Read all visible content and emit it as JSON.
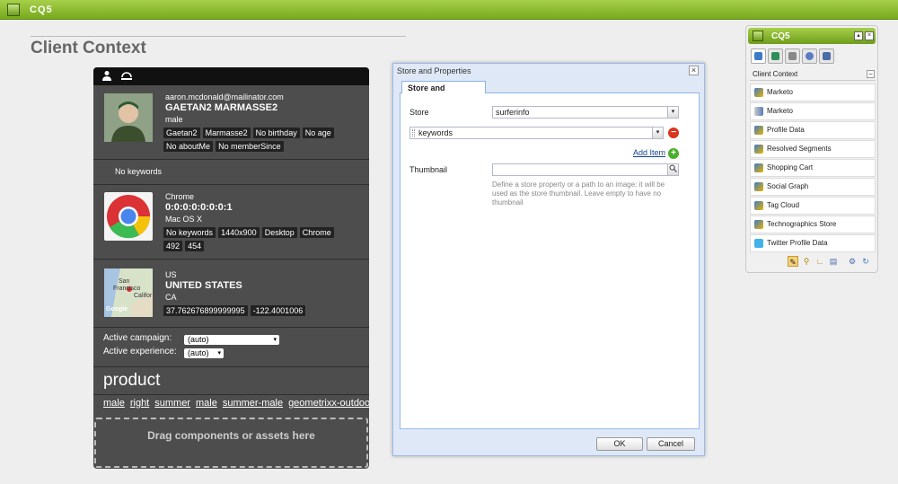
{
  "topbar": {
    "brand": "CQ5"
  },
  "page_title": "Client Context",
  "client_context": {
    "profile": {
      "email": "aaron.mcdonald@mailinator.com",
      "name": "GAETAN2 MARMASSE2",
      "gender": "male",
      "tags": [
        "Gaetan2",
        "Marmasse2",
        "No birthday",
        "No age",
        "No aboutMe",
        "No memberSince"
      ]
    },
    "keywords_text": "No keywords",
    "browser": {
      "name": "Chrome",
      "ip": "0:0:0:0:0:0:0:1",
      "os": "Mac OS X",
      "tags": [
        "No keywords",
        "1440x900",
        "Desktop",
        "Chrome",
        "492",
        "454"
      ]
    },
    "geo": {
      "country_code": "US",
      "country": "UNITED STATES",
      "region": "CA",
      "map_labels": [
        "San",
        "Francisco",
        "Califor",
        "Google"
      ],
      "tags": [
        "37.762676899999995",
        "-122.4001006"
      ]
    },
    "campaign": {
      "label": "Active campaign:",
      "value": "(auto)"
    },
    "experience": {
      "label": "Active experience:",
      "value": "(auto)"
    },
    "product_heading": "product",
    "segments": [
      "male",
      "right",
      "summer",
      "male",
      "summer-male",
      "geometrixx-outdoors"
    ],
    "dropzone": "Drag components or assets here"
  },
  "dialog": {
    "title": "Store and Properties",
    "tab": "Store and Properties",
    "store_label": "Store",
    "store_value": "surferinfo",
    "keyword_value": "keywords",
    "add_item": "Add Item",
    "thumbnail_label": "Thumbnail",
    "thumbnail_value": "",
    "hint": "Define a store property or a path to an image: it will be used as the store thumbnail. Leave empty to have no thumbnail",
    "ok": "OK",
    "cancel": "Cancel"
  },
  "sidekick": {
    "brand": "CQ5",
    "section": "Client Context",
    "items": [
      "Marketo",
      "Marketo",
      "Profile Data",
      "Resolved Segments",
      "Shopping Cart",
      "Social Graph",
      "Tag Cloud",
      "Technographics Store",
      "Twitter Profile Data"
    ]
  },
  "colors": {
    "brand_green": "#77a81d",
    "panel_bg": "#4d4d4d",
    "dialog_bg": "#dfe8f6",
    "link_blue": "#15428b",
    "remove_red": "#d9341f",
    "add_green": "#4caf2c"
  }
}
